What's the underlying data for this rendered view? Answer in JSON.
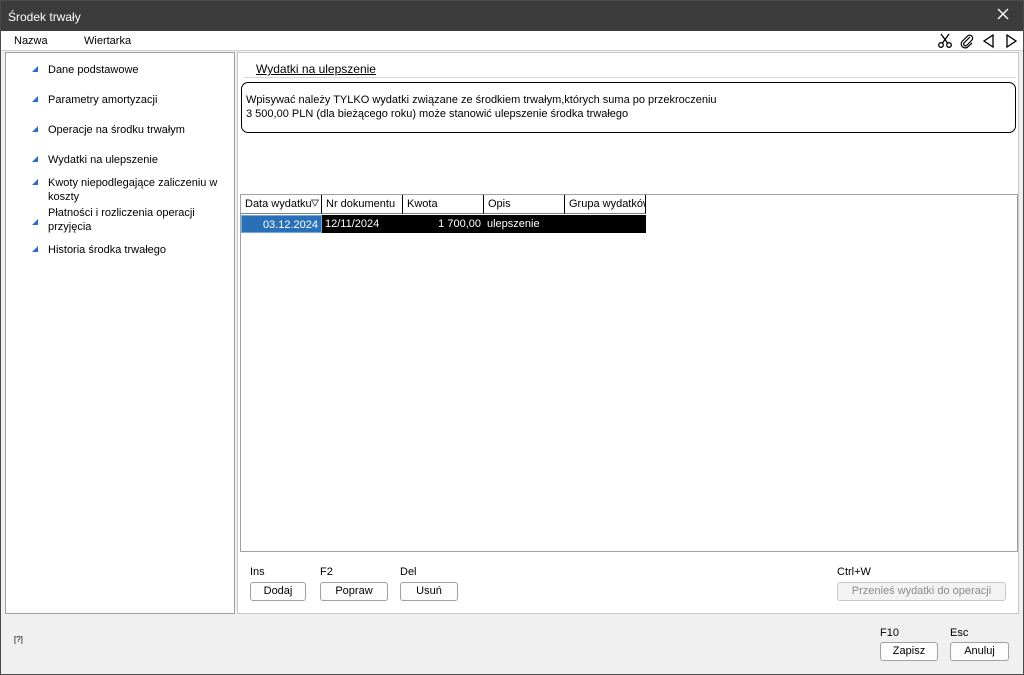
{
  "window": {
    "title": "Środek trwały"
  },
  "menu": {
    "name_label": "Nazwa",
    "value": "Wiertarka"
  },
  "toolbar": {
    "icons": [
      "scissors-icon",
      "paperclip-icon",
      "prev-arrow-icon",
      "next-arrow-icon"
    ]
  },
  "sidebar": {
    "items": [
      {
        "label": "Dane podstawowe",
        "mnemonic": "s"
      },
      {
        "label": "Parametry amortyzacji",
        "mnemonic": "m"
      },
      {
        "label": "Operacje na środku trwałym",
        "mnemonic": "O"
      },
      {
        "label": "Wydatki na ulepszenie",
        "mnemonic": "W"
      },
      {
        "label": "Kwoty niepodlegające zaliczeniu w koszty",
        "mnemonic": "K"
      },
      {
        "label": "Płatności i rozliczenia operacji przyjęcia",
        "mnemonic": "P"
      },
      {
        "label": "Historia środka trwałego",
        "mnemonic": "H"
      }
    ]
  },
  "main": {
    "section_title": "Wydatki na ulepszenie",
    "info_line1": "Wpisywać należy TYLKO wydatki związane ze środkiem trwałym,których suma po przekroczeniu",
    "info_line2": "3 500,00 PLN (dla bieżącego roku) może stanowić ulepszenie środka trwałego"
  },
  "grid": {
    "columns": [
      "Data wydatku",
      "Nr dokumentu",
      "Kwota",
      "Opis",
      "Grupa wydatków"
    ],
    "rows": [
      {
        "date": "03.12.2024",
        "doc": "12/11/2024",
        "amount": "1 700,00",
        "desc": "ulepszenie",
        "group": ""
      }
    ]
  },
  "actions": {
    "add": {
      "shortcut": "Ins",
      "label": "Dodaj"
    },
    "edit": {
      "shortcut": "F2",
      "label": "Popraw"
    },
    "delete": {
      "shortcut": "Del",
      "label": "Usuń"
    },
    "transfer": {
      "shortcut": "Ctrl+W",
      "label": "Przenieś wydatki do operacji"
    }
  },
  "footer": {
    "status_icon": "[?]",
    "save": {
      "shortcut": "F10",
      "label": "Zapisz"
    },
    "cancel": {
      "shortcut": "Esc",
      "label": "Anuluj"
    }
  },
  "colors": {
    "titlebar": "#3c3c3c",
    "selection": "#2a70b8",
    "nav_triangle": "#2a6cc7"
  }
}
